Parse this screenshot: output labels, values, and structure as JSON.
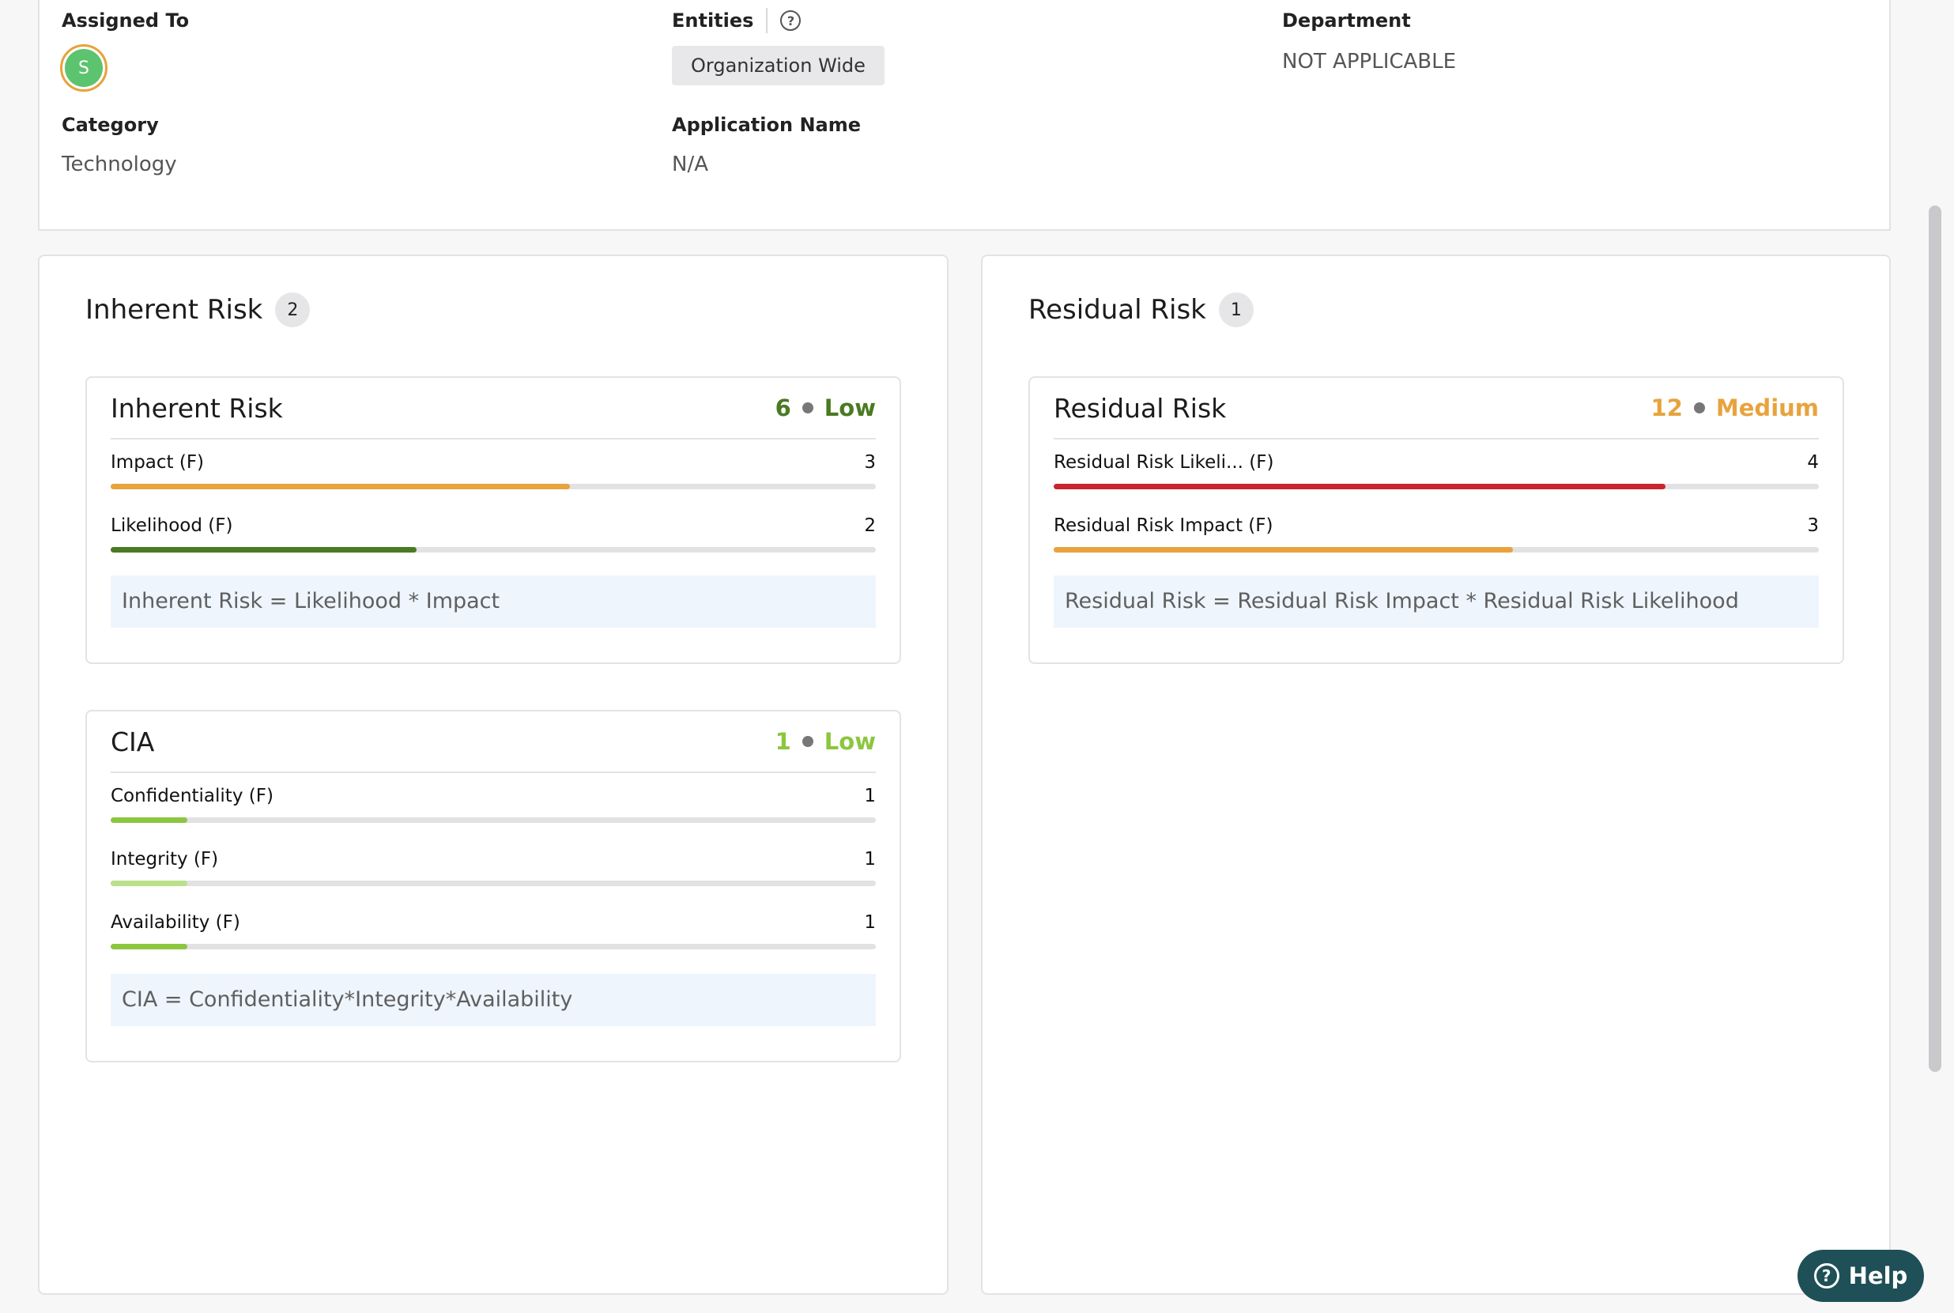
{
  "details": {
    "assigned_to": {
      "label": "Assigned To",
      "avatar_initial": "S"
    },
    "entities": {
      "label": "Entities",
      "help_glyph": "?",
      "chip": "Organization Wide"
    },
    "department": {
      "label": "Department",
      "value": "NOT APPLICABLE"
    },
    "category": {
      "label": "Category",
      "value": "Technology"
    },
    "application_name": {
      "label": "Application Name",
      "value": "N/A"
    }
  },
  "inherent_panel": {
    "title": "Inherent Risk",
    "count": "2",
    "cards": [
      {
        "title": "Inherent Risk",
        "score": "6",
        "level": "Low",
        "score_color": "#4a7a22",
        "rows": [
          {
            "label": "Impact (F)",
            "value": "3",
            "fill_fraction": 0.6,
            "color": "#e8a33d"
          },
          {
            "label": "Likelihood (F)",
            "value": "2",
            "fill_fraction": 0.4,
            "color": "#4a7a22"
          }
        ],
        "formula": "Inherent Risk = Likelihood * Impact"
      },
      {
        "title": "CIA",
        "score": "1",
        "level": "Low",
        "score_color": "#8cc63f",
        "rows": [
          {
            "label": "Confidentiality (F)",
            "value": "1",
            "fill_fraction": 0.1,
            "color": "#8cc63f"
          },
          {
            "label": "Integrity (F)",
            "value": "1",
            "fill_fraction": 0.1,
            "color": "#b9e08a"
          },
          {
            "label": "Availability (F)",
            "value": "1",
            "fill_fraction": 0.1,
            "color": "#8cc63f"
          }
        ],
        "formula": "CIA = Confidentiality*Integrity*Availability"
      }
    ]
  },
  "residual_panel": {
    "title": "Residual Risk",
    "count": "1",
    "cards": [
      {
        "title": "Residual Risk",
        "score": "12",
        "level": "Medium",
        "score_color": "#e8a33d",
        "rows": [
          {
            "label": "Residual Risk Likeli... (F)",
            "value": "4",
            "fill_fraction": 0.8,
            "color": "#c9252c"
          },
          {
            "label": "Residual Risk Impact (F)",
            "value": "3",
            "fill_fraction": 0.6,
            "color": "#e8a33d"
          }
        ],
        "formula": "Residual Risk = Residual Risk Impact * Residual Risk Likelihood"
      }
    ]
  },
  "help_button": {
    "label": "Help",
    "icon": "help-circle-icon"
  },
  "colors": {
    "accent": "#1f4f57",
    "avatar": "#5cc36e",
    "avatar_ring": "#e8a23a"
  }
}
